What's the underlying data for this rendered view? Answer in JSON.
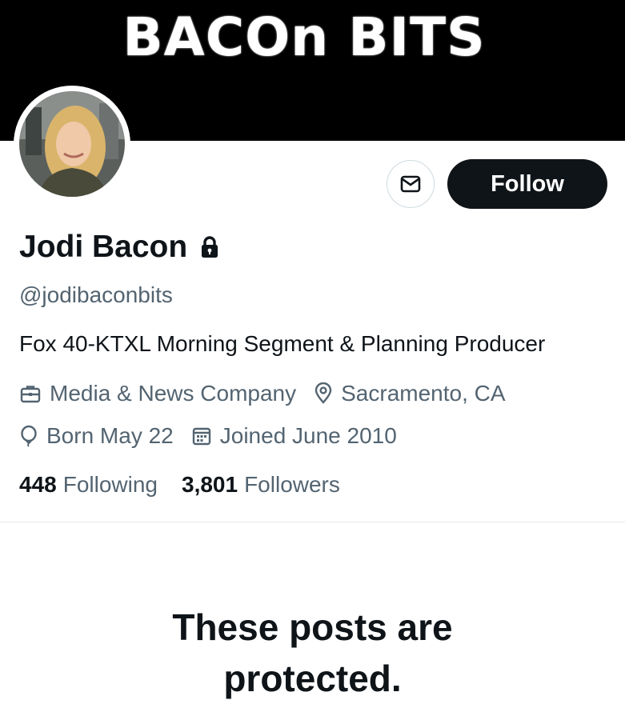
{
  "banner": {
    "text": "BACOn BITS"
  },
  "profile": {
    "name": "Jodi Bacon",
    "handle": "@jodibaconbits",
    "bio": "Fox 40-KTXL Morning Segment & Planning Producer",
    "category": "Media & News Company",
    "location": "Sacramento, CA",
    "birthday": "Born May 22",
    "joined": "Joined June 2010",
    "protected_icon": "lock-icon"
  },
  "actions": {
    "message_icon": "envelope-icon",
    "follow_label": "Follow"
  },
  "stats": {
    "following_count": "448",
    "following_label": "Following",
    "followers_count": "3,801",
    "followers_label": "Followers"
  },
  "notice": {
    "line1": "These posts are",
    "line2": "protected."
  },
  "colors": {
    "primary_text": "#0f1419",
    "secondary_text": "#536471",
    "follow_bg": "#0f1419",
    "border": "#cfd9de"
  }
}
